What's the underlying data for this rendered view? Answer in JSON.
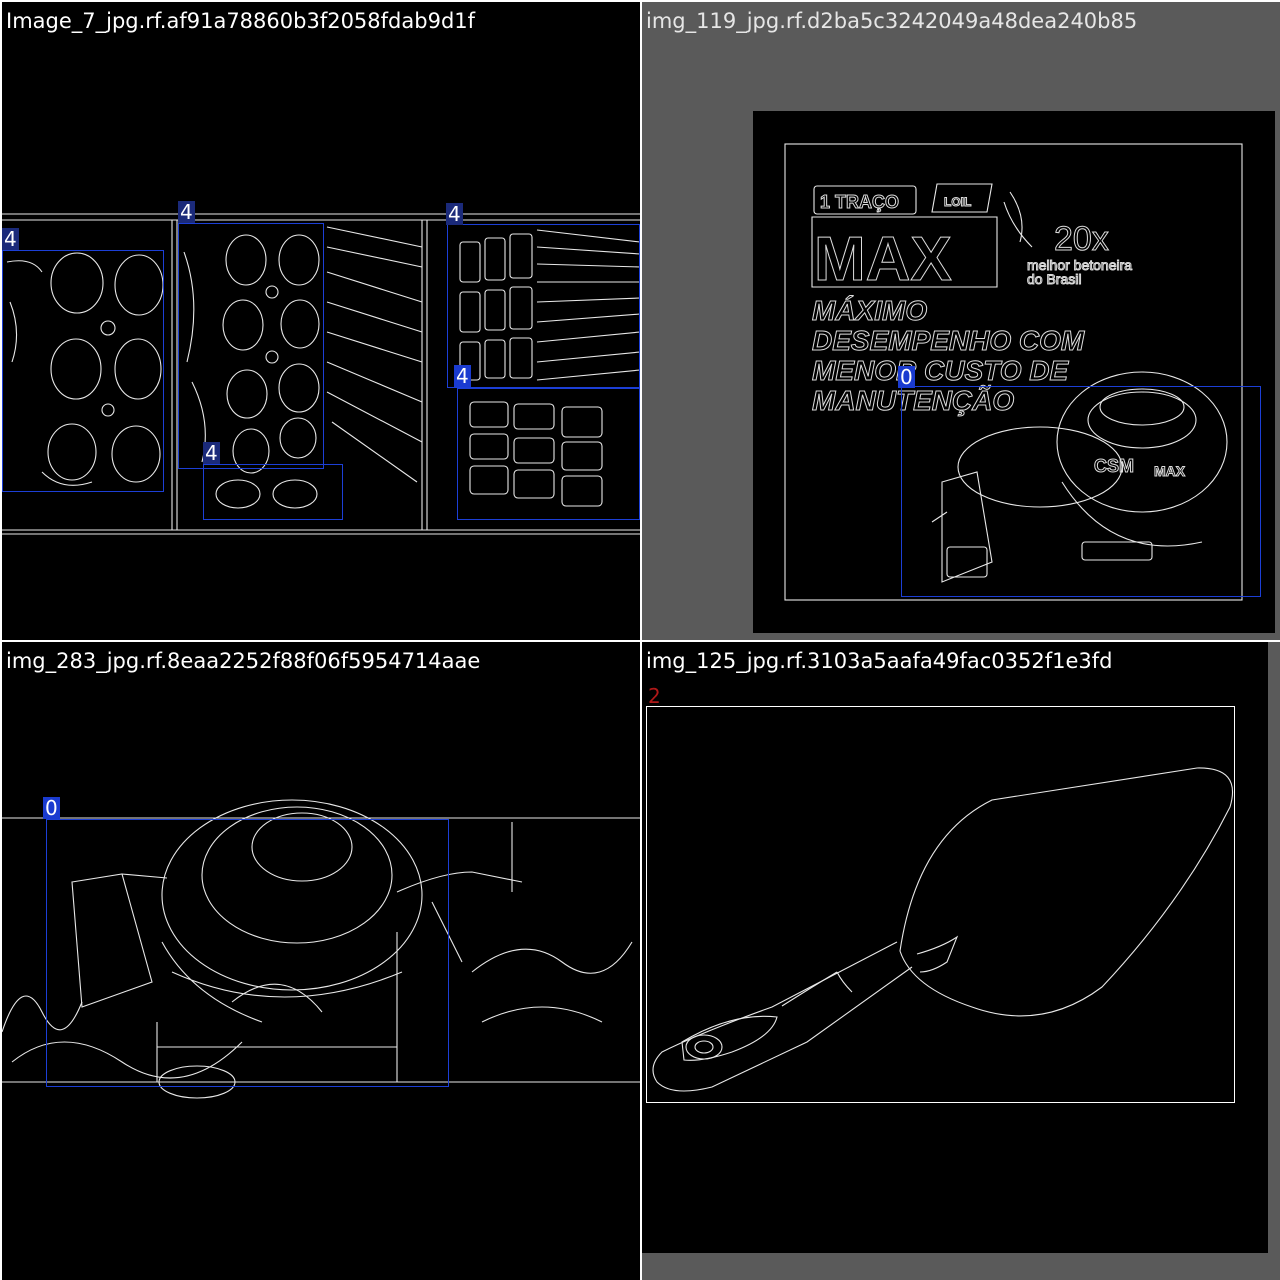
{
  "tiles": [
    {
      "title": "Image_7_jpg.rf.af91a78860b3f2058fdab9d1f",
      "labels": [
        "4",
        "4",
        "4",
        "4",
        "4"
      ]
    },
    {
      "title": "img_119_jpg.rf.d2ba5c3242049a48dea240b85",
      "labels": [
        "0"
      ],
      "poster": {
        "badge": "1 TRAÇO",
        "small_tag": "LOIL",
        "brand": "MAX",
        "award_big": "20x",
        "award_line1": "melhor betoneira",
        "award_line2": "do Brasil",
        "headline1": "MÁXIMO",
        "headline2": "DESEMPENHO COM",
        "headline3": "MENOR CUSTO DE",
        "headline4": "MANUTENÇÃO",
        "product_logo": "CSM",
        "product_model": "MAX"
      }
    },
    {
      "title": "img_283_jpg.rf.8eaa2252f88f06f5954714aae",
      "labels": [
        "0"
      ]
    },
    {
      "title": "img_125_jpg.rf.3103a5aafa49fac0352f1e3fd",
      "labels": [
        "2"
      ]
    }
  ],
  "colors": {
    "background": "#000000",
    "edge_lines": "#e8e8e8",
    "box_blue": "#1c3fd6",
    "label_dark_blue": "#1b2a7a",
    "box_white": "#ffffff",
    "label_red": "#b01818",
    "gray_margin": "#5a5a5a"
  }
}
